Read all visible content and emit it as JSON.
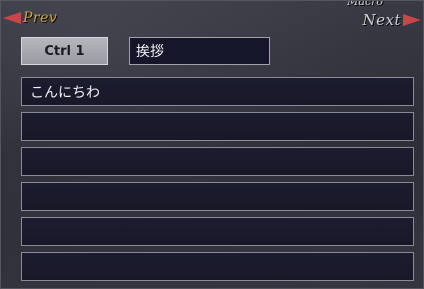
{
  "nav": {
    "prev_label": "Prev",
    "next_label": "Next",
    "title": "Macro",
    "arrow_color": "#c8454a"
  },
  "header": {
    "key_label": "Ctrl 1",
    "macro_name": "挨拶"
  },
  "lines": [
    "こんにちわ",
    "",
    "",
    "",
    "",
    ""
  ]
}
